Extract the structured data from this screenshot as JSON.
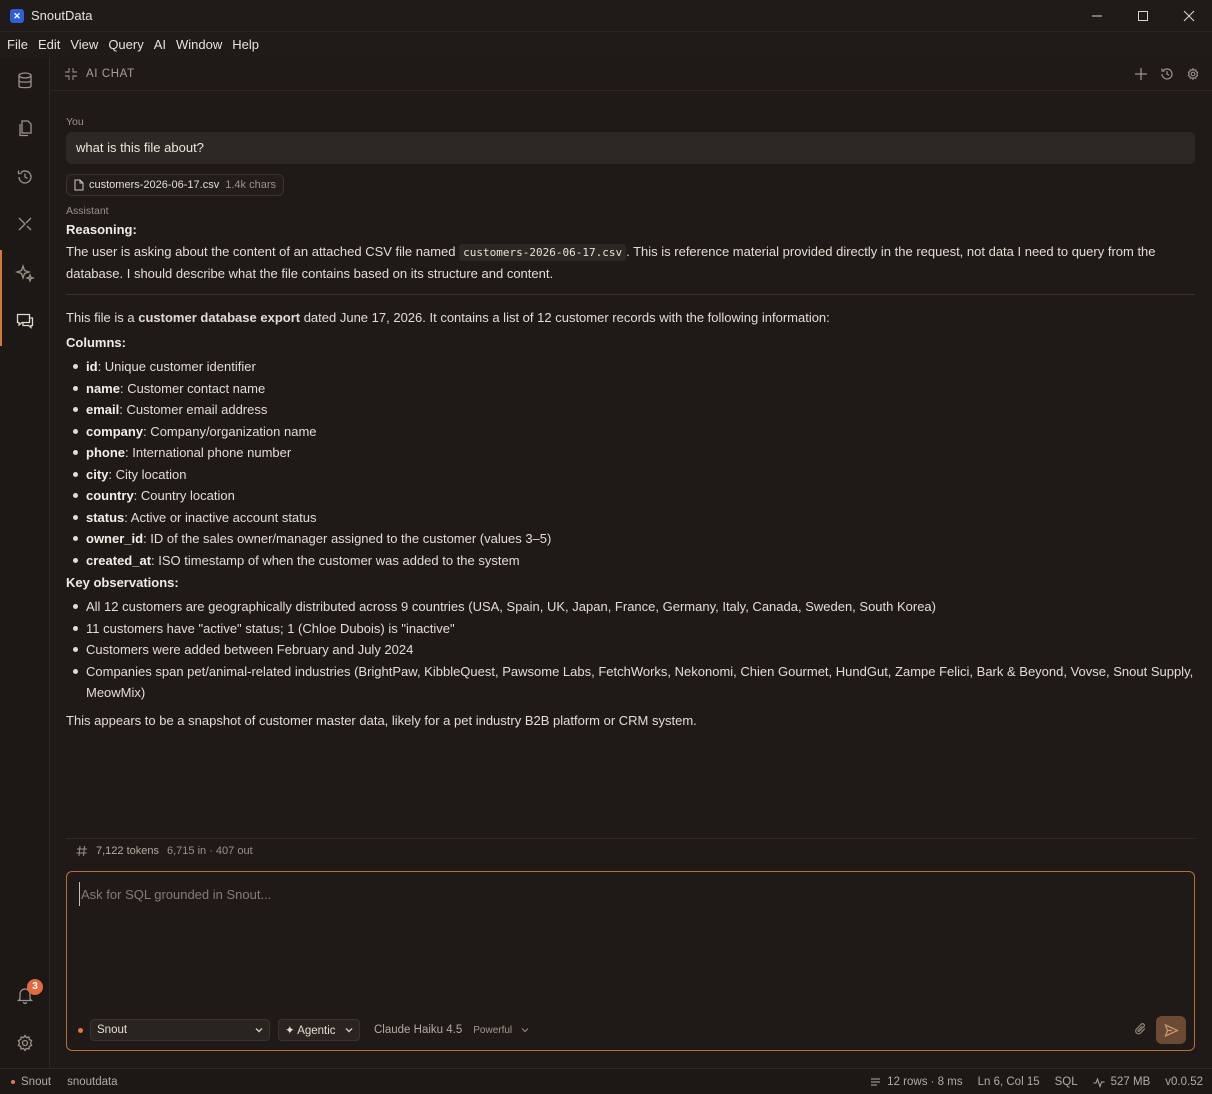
{
  "window": {
    "title": "SnoutData",
    "logo_glyph": "✕"
  },
  "menu": [
    "File",
    "Edit",
    "View",
    "Query",
    "AI",
    "Window",
    "Help"
  ],
  "activity_bar": {
    "notification_count": "3"
  },
  "panel": {
    "title": "AI CHAT"
  },
  "chat": {
    "user_role": "You",
    "user_message": "what is this file about?",
    "attachment": {
      "name": "customers-2026-06-17.csv",
      "size": "1.4k chars"
    },
    "assistant_role": "Assistant",
    "reasoning_label": "Reasoning:",
    "reasoning": {
      "before": "The user is asking about the content of an attached CSV file named ",
      "code": "customers-2026-06-17.csv",
      "after": ". This is reference material provided directly in the request, not data I need to query from the database. I should describe what the file contains based on its structure and content."
    },
    "intro": {
      "before": "This file is a ",
      "bold": "customer database export",
      "after": " dated June 17, 2026. It contains a list of 12 customer records with the following information:"
    },
    "columns_label": "Columns:",
    "columns": [
      {
        "name": "id",
        "desc": ": Unique customer identifier"
      },
      {
        "name": "name",
        "desc": ": Customer contact name"
      },
      {
        "name": "email",
        "desc": ": Customer email address"
      },
      {
        "name": "company",
        "desc": ": Company/organization name"
      },
      {
        "name": "phone",
        "desc": ": International phone number"
      },
      {
        "name": "city",
        "desc": ": City location"
      },
      {
        "name": "country",
        "desc": ": Country location"
      },
      {
        "name": "status",
        "desc": ": Active or inactive account status"
      },
      {
        "name": "owner_id",
        "desc": ": ID of the sales owner/manager assigned to the customer (values 3–5)"
      },
      {
        "name": "created_at",
        "desc": ": ISO timestamp of when the customer was added to the system"
      }
    ],
    "observations_label": "Key observations:",
    "observations": [
      "All 12 customers are geographically distributed across 9 countries (USA, Spain, UK, Japan, France, Germany, Italy, Canada, Sweden, South Korea)",
      "11 customers have \"active\" status; 1 (Chloe Dubois) is \"inactive\"",
      "Customers were added between February and July 2024",
      "Companies span pet/animal-related industries (BrightPaw, KibbleQuest, Pawsome Labs, FetchWorks, Nekonomi, Chien Gourmet, HundGut, Zampe Felici, Bark & Beyond, Vovse, Snout Supply, MeowMix)"
    ],
    "closing": "This appears to be a snapshot of customer master data, likely for a pet industry B2B platform or CRM system."
  },
  "tokens": {
    "total": "7,122 tokens",
    "split": "6,715 in · 407 out"
  },
  "composer": {
    "placeholder": "Ask for SQL grounded in Snout...",
    "connection": "Snout",
    "mode": "✦ Agentic",
    "model": "Claude Haiku 4.5",
    "tier": "Powerful"
  },
  "statusbar": {
    "connection": "Snout",
    "database": "snoutdata",
    "result": "12 rows · 8 ms",
    "cursor": "Ln 6, Col 15",
    "language": "SQL",
    "memory": "527 MB",
    "version": "v0.0.52"
  },
  "colors": {
    "accent": "#d2783a",
    "background": "#1f1a17",
    "badge": "#e26a3f"
  }
}
